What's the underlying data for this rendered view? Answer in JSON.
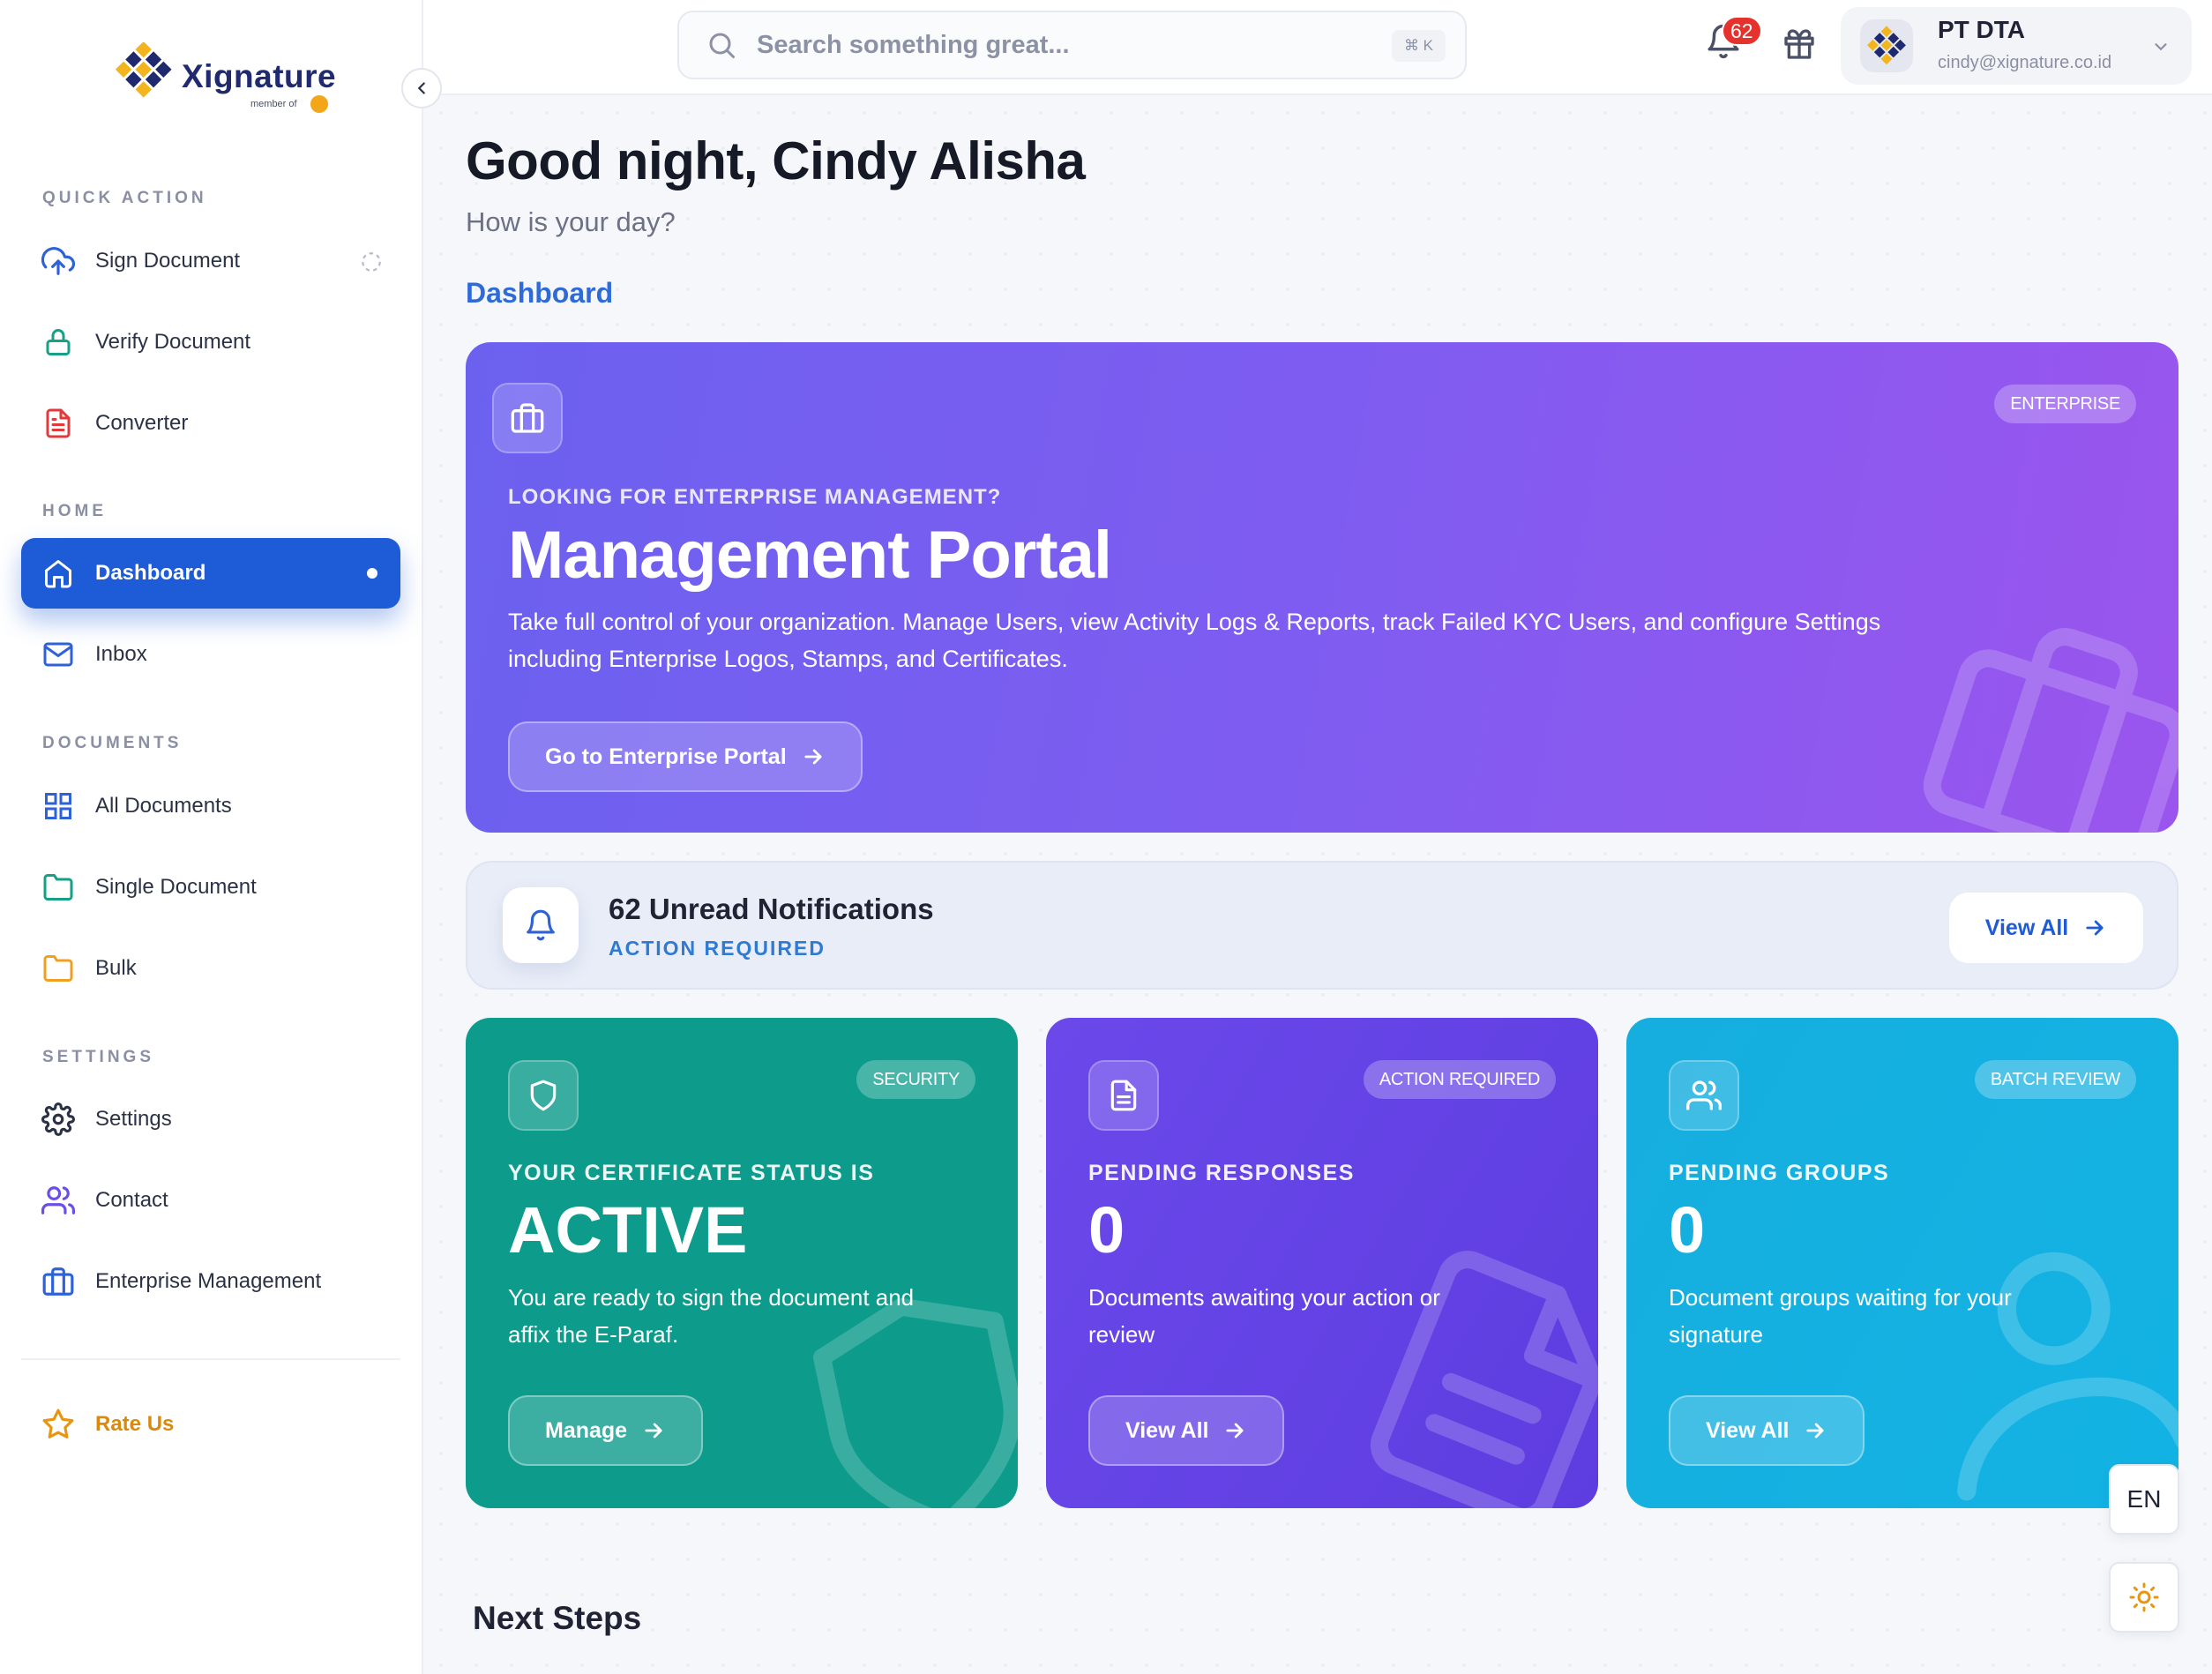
{
  "brand": {
    "name": "Xignature",
    "sub": "member of"
  },
  "sidebar": {
    "sections": {
      "quick_action": "QUICK ACTION",
      "home": "HOME",
      "documents": "DOCUMENTS",
      "settings": "SETTINGS"
    },
    "items": [
      {
        "label": "Sign Document",
        "icon": "cloud-upload-icon"
      },
      {
        "label": "Verify Document",
        "icon": "lock-icon"
      },
      {
        "label": "Converter",
        "icon": "file-text-icon"
      },
      {
        "label": "Dashboard",
        "icon": "home-icon",
        "active": true
      },
      {
        "label": "Inbox",
        "icon": "mail-icon"
      },
      {
        "label": "All Documents",
        "icon": "grid-icon"
      },
      {
        "label": "Single Document",
        "icon": "folder-icon"
      },
      {
        "label": "Bulk",
        "icon": "folder-icon"
      },
      {
        "label": "Settings",
        "icon": "gear-icon"
      },
      {
        "label": "Contact",
        "icon": "users-icon"
      },
      {
        "label": "Enterprise Management",
        "icon": "briefcase-icon"
      },
      {
        "label": "Rate Us",
        "icon": "star-icon"
      }
    ]
  },
  "topbar": {
    "search_placeholder": "Search something great...",
    "search_shortcut": "⌘ K",
    "notification_count": "62",
    "user": {
      "name": "PT DTA",
      "email": "cindy@xignature.co.id"
    }
  },
  "main": {
    "greeting": "Good night, Cindy Alisha",
    "subgreeting": "How is your day?",
    "breadcrumb": "Dashboard",
    "portal": {
      "badge": "ENTERPRISE",
      "eyebrow": "LOOKING FOR ENTERPRISE MANAGEMENT?",
      "title": "Management Portal",
      "description": "Take full control of your organization. Manage Users, view Activity Logs & Reports, track Failed KYC Users, and configure Settings including Enterprise Logos, Stamps, and Certificates.",
      "button": "Go to Enterprise Portal"
    },
    "notifications": {
      "title": "62 Unread Notifications",
      "subtitle": "ACTION REQUIRED",
      "button": "View All"
    },
    "cards": [
      {
        "badge": "SECURITY",
        "eyebrow": "YOUR CERTIFICATE STATUS IS",
        "value": "ACTIVE",
        "description": "You are ready to sign the document and affix the E-Paraf.",
        "button": "Manage",
        "color": "#0d9b8b"
      },
      {
        "badge": "ACTION REQUIRED",
        "eyebrow": "PENDING RESPONSES",
        "value": "0",
        "description": "Documents awaiting your action or review",
        "button": "View All",
        "color": "#6546e6"
      },
      {
        "badge": "BATCH REVIEW",
        "eyebrow": "PENDING GROUPS",
        "value": "0",
        "description": "Document groups waiting for your signature",
        "button": "View All",
        "color": "#14b0e0"
      }
    ],
    "next_steps": "Next Steps"
  },
  "floating": {
    "language": "EN",
    "theme_icon": "sun-icon"
  },
  "colors": {
    "primary": "#1e5bd6",
    "portal_gradient_start": "#6c61ef",
    "portal_gradient_end": "#9a55ee",
    "alert": "#e5322d",
    "rate_us": "#d98a0c"
  }
}
